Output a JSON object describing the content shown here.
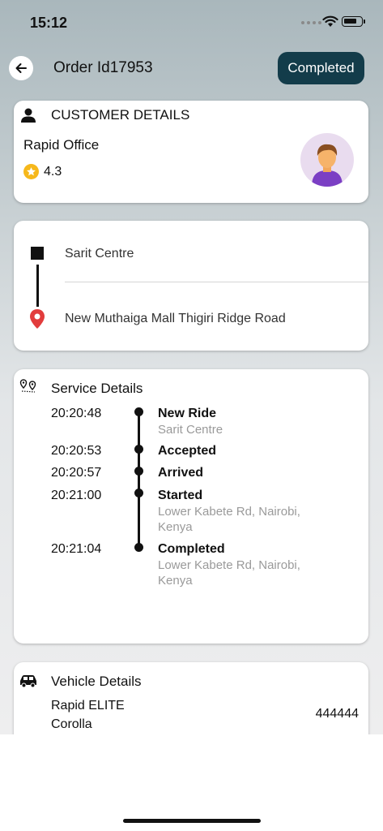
{
  "status_bar": {
    "time": "15:12"
  },
  "header": {
    "title": "Order Id17953",
    "status": "Completed"
  },
  "customer": {
    "section_title": "CUSTOMER DETAILS",
    "name": "Rapid Office",
    "rating": "4.3"
  },
  "route": {
    "pickup": "Sarit Centre",
    "dropoff": "New Muthaiga Mall Thigiri Ridge Road"
  },
  "service": {
    "section_title": "Service Details",
    "timeline": [
      {
        "time": "20:20:48",
        "event": "New Ride",
        "location": "Sarit Centre"
      },
      {
        "time": "20:20:53",
        "event": "Accepted",
        "location": ""
      },
      {
        "time": "20:20:57",
        "event": "Arrived",
        "location": ""
      },
      {
        "time": "20:21:00",
        "event": "Started",
        "location": "Lower Kabete Rd, Nairobi, Kenya"
      },
      {
        "time": "20:21:04",
        "event": "Completed",
        "location": "Lower Kabete Rd, Nairobi, Kenya"
      }
    ]
  },
  "vehicle": {
    "section_title": "Vehicle Details",
    "name": "Rapid ELITE\nCorolla",
    "plate": "444444"
  },
  "colors": {
    "status_pill": "#133c4a",
    "star": "#f6b81b",
    "pin": "#e23c3c"
  }
}
